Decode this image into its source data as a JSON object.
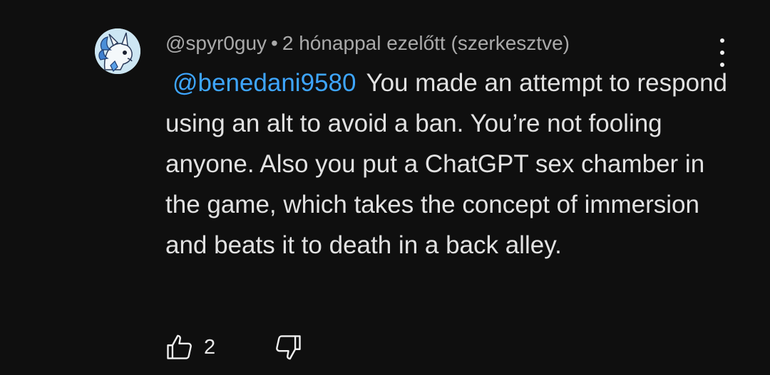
{
  "comment": {
    "author": "@spyr0guy",
    "separator": "•",
    "timestamp": "2 hónappal ezelőtt (szerkesztve)",
    "mention": "@benedani9580",
    "text": "You made an attempt to respond using an alt to avoid a ban. You’re not fooling anyone. Also you put a ChatGPT sex chamber in the game, which takes the concept of immersion and beats it to death in a back alley.",
    "like_count": "2"
  },
  "icons": {
    "avatar": "avatar-image",
    "menu": "more-vert-icon",
    "like": "thumb-up-icon",
    "dislike": "thumb-down-icon"
  },
  "colors": {
    "background": "#0f0f0f",
    "mention": "#3ea6ff",
    "meta": "#aaaaaa",
    "text": "#e2e2e2"
  }
}
